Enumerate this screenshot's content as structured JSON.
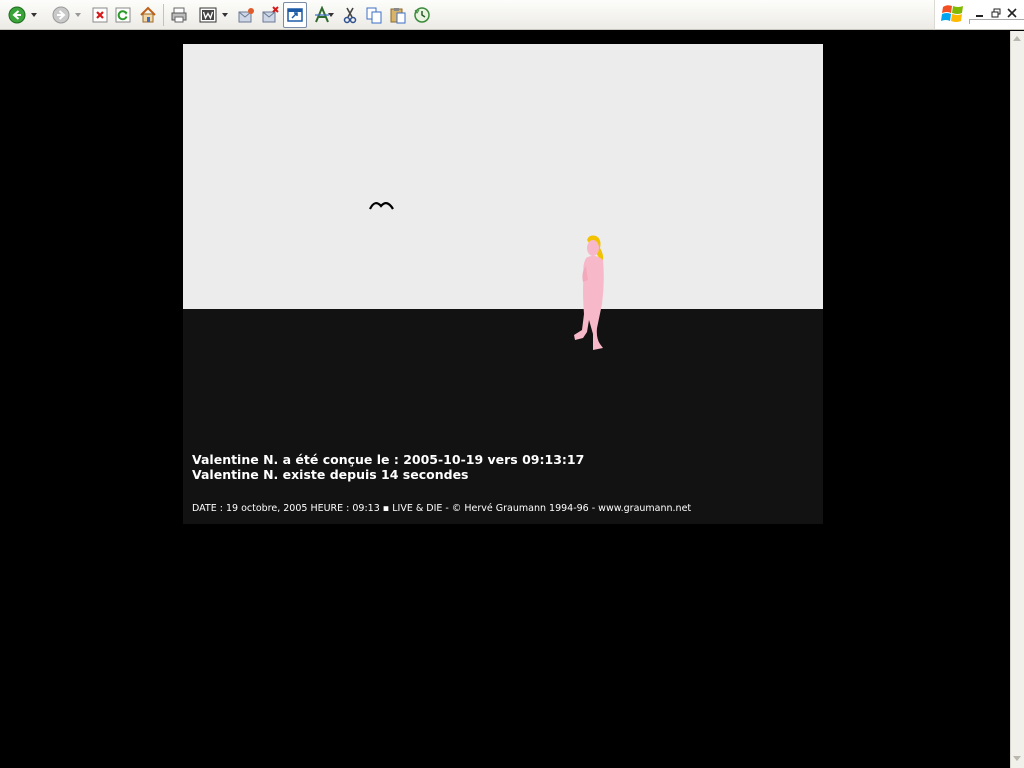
{
  "toolbar": {
    "icons": [
      "back-icon",
      "dropdown-arrow-icon",
      "forward-icon",
      "dropdown-arrow-icon",
      "stop-icon",
      "refresh-icon",
      "home-icon",
      "print-icon",
      "word-icon",
      "dropdown-arrow-icon",
      "mail-icon",
      "delete-mail-icon",
      "window-icon",
      "font-icon",
      "dropdown-arrow-icon",
      "cut-icon",
      "copy-icon",
      "paste-icon",
      "history-icon"
    ]
  },
  "brand": {
    "logo": "windows-logo-icon"
  },
  "scene": {
    "line1": "Valentine N. a été conçue le : 2005-10-19 vers 09:13:17",
    "line2": "Valentine N. existe depuis 14 secondes",
    "footer": "DATE : 19 octobre, 2005  HEURE : 09:13  ▪  LIVE & DIE - © Hervé Graumann 1994-96 - www.graumann.net"
  },
  "colors": {
    "sky": "#ececec",
    "ground": "#121212",
    "page": "#000000",
    "figure": "#f7b9c9",
    "hair": "#f2c100"
  }
}
